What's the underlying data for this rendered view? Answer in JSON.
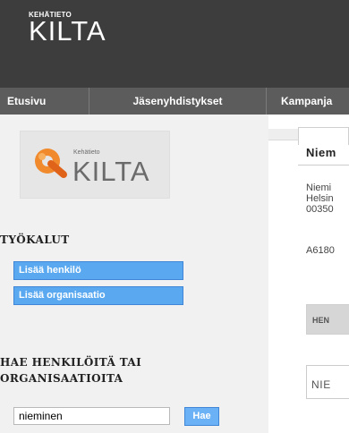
{
  "brand": {
    "small": "KEHÄTIETO",
    "big": "KILTA"
  },
  "nav": [
    "Etusivu",
    "Jäsenyhdistykset",
    "Kampanja"
  ],
  "logo": {
    "small": "Kehätieto",
    "big": "KILTA"
  },
  "tools": {
    "title": "TYÖKALUT",
    "add_person": "Lisää henkilö",
    "add_org": "Lisää organisaatio"
  },
  "search": {
    "title_line1": "HAE HENKILÖITÄ TAI",
    "title_line2": "ORGANISAATIOITA",
    "value": "nieminen",
    "button": "Hae"
  },
  "main": {
    "tab": "Niem",
    "address": [
      "Niemi",
      "Helsin",
      "00350"
    ],
    "code": "A6180",
    "grey_button": "HEN",
    "outline_button": "NIE"
  },
  "colors": {
    "header": "#3d3d3d",
    "nav": "#5c5c5c",
    "button": "#5aa9f0",
    "accent_logo": "#f08a2c"
  }
}
